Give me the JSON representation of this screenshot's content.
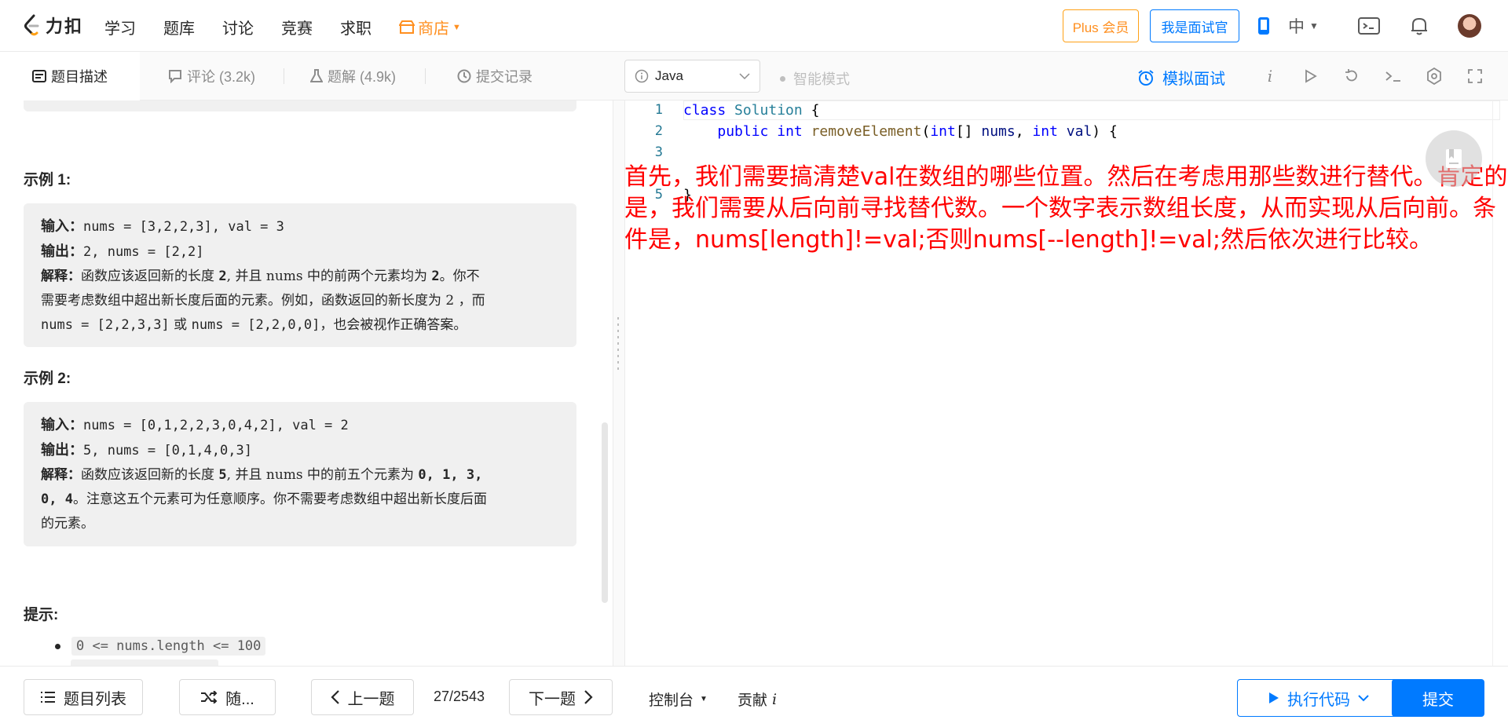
{
  "brand": {
    "name": "力扣"
  },
  "nav": {
    "items": [
      "学习",
      "题库",
      "讨论",
      "竞赛",
      "求职"
    ],
    "store": "商店",
    "plus": "Plus 会员",
    "interviewer": "我是面试官",
    "language": "中"
  },
  "tabs": {
    "description": "题目描述",
    "comments": "评论 (3.2k)",
    "solutions": "题解 (4.9k)",
    "submissions": "提交记录"
  },
  "editor_toolbar": {
    "language": "Java",
    "smart_mode": "智能模式",
    "mock_interview": "模拟面试",
    "info": "i"
  },
  "examples": [
    {
      "title": "示例 1:",
      "input_label": "输入：",
      "input": "nums = [3,2,2,3], val = 3",
      "output_label": "输出：",
      "output": "2, nums = [2,2]",
      "explain_label": "解释：",
      "explain_l1": "函数应该返回新的长度 ",
      "explain_b1": "2",
      "explain_l1b": ", 并且 nums 中的前两个元素均为 ",
      "explain_b2": "2",
      "explain_l1c": "。你不",
      "explain_l2": "需要考虑数组中超出新长度后面的元素。例如，函数返回的新长度为 2 ，而",
      "explain_l3a": "nums = [2,2,3,3]",
      "explain_l3b": " 或 ",
      "explain_l3c": "nums = [2,2,0,0]",
      "explain_l3d": "，也会被视作正确答案。"
    },
    {
      "title": "示例 2:",
      "input_label": "输入：",
      "input": "nums = [0,1,2,2,3,0,4,2], val = 2",
      "output_label": "输出：",
      "output": "5, nums = [0,1,4,0,3]",
      "explain_label": "解释：",
      "explain_l1": "函数应该返回新的长度 ",
      "explain_b1": "5",
      "explain_l1b": ", 并且 nums 中的前五个元素为 ",
      "explain_b2": "0, 1, 3,",
      "explain_l2a": "0, 4",
      "explain_l2b": "。注意这五个元素可为任意顺序。你不需要考虑数组中超出新长度后面",
      "explain_l3": "的元素。"
    }
  ],
  "hints": {
    "title": "提示:",
    "items": [
      "0 <= nums.length <= 100"
    ]
  },
  "code": {
    "line_numbers": [
      "1",
      "2",
      "3",
      "5"
    ],
    "line1": {
      "kw": "class",
      "name": "Solution",
      "rest": " {"
    },
    "line2": {
      "indent": "    ",
      "kw1": "public",
      "kw2": "int",
      "fn": "removeElement",
      "p1": "(",
      "t1": "int",
      "p2": "[] ",
      "v1": "nums",
      "p3": ", ",
      "t2": "int",
      "v2": "val",
      "p4": ") {"
    },
    "line5": "}"
  },
  "annotation": "首先，我们需要搞清楚val在数组的哪些位置。然后在考虑用那些数进行替代。肯定的是，我们需要从后向前寻找替代数。一个数字表示数组长度，从而实现从后向前。条件是，nums[length]!=val;否则nums[--length]!=val;然后依次进行比较。",
  "bottom": {
    "problem_list": "题目列表",
    "random": "随...",
    "prev": "上一题",
    "pager": "27/2543",
    "next": "下一题",
    "console": "控制台",
    "contribute": "贡献",
    "contribute_i": "i",
    "run": "执行代码",
    "submit": "提交"
  },
  "colors": {
    "accent": "#007aff",
    "store": "#ff8f1f",
    "annotation": "#ff0000"
  }
}
